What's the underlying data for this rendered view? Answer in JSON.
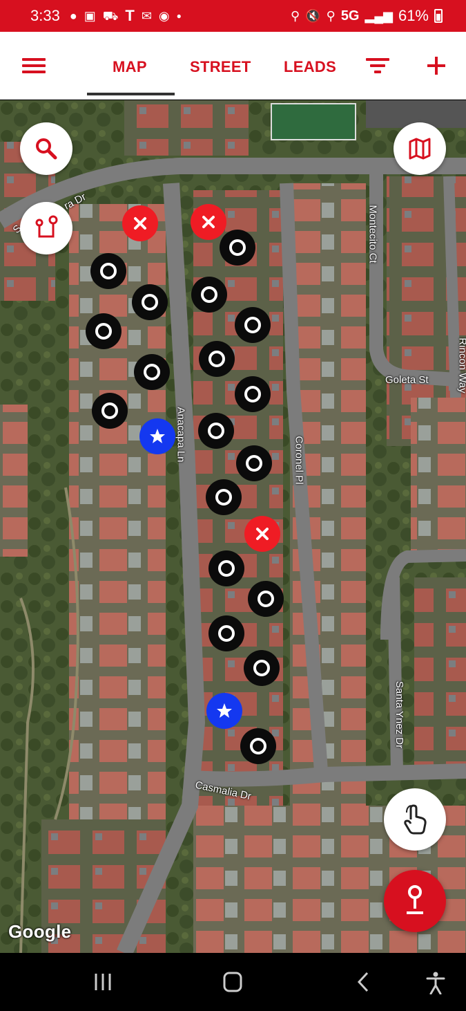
{
  "status_bar": {
    "time": "3:33",
    "network": "5G",
    "battery": "61%",
    "left_icons": [
      "chat-icon",
      "notification-icon",
      "car-icon",
      "tmobile-icon",
      "gmail-icon",
      "app-icon",
      "dot-icon"
    ],
    "right_icons": [
      "key-icon",
      "mute-icon",
      "location-icon",
      "signal-icon",
      "battery-icon"
    ]
  },
  "nav": {
    "tabs": [
      {
        "label": "MAP",
        "active": true
      },
      {
        "label": "STREET",
        "active": false
      },
      {
        "label": "LEADS",
        "active": false
      }
    ],
    "accent": "#d7101f"
  },
  "map": {
    "street_labels": [
      "Anacapa Ln",
      "Coronel Pl",
      "Goleta St",
      "Montecito Ct",
      "Santa Ynez Dr",
      "Casmalia Dr",
      "Rincon Way",
      "ra Dr",
      "S"
    ],
    "attribution": "Google",
    "pin_colors": {
      "black": "#0b0b0b",
      "red": "#ef1c24",
      "blue": "#1438f0"
    }
  }
}
